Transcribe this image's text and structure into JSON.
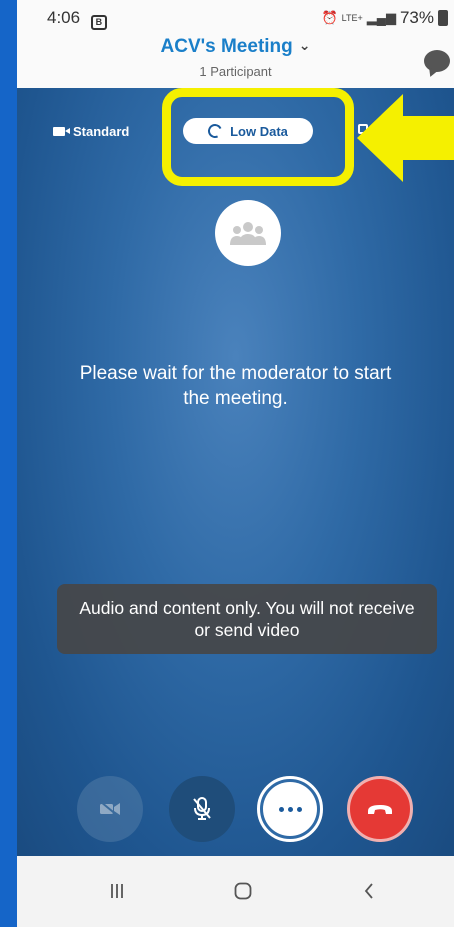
{
  "status_bar": {
    "time": "4:06",
    "notification_badge": "B",
    "signal_text": "LTE+",
    "battery": "73%"
  },
  "header": {
    "title": "ACV's Meeting",
    "participants": "1 Participant"
  },
  "modes": {
    "standard_label": "Standard",
    "low_data_label": "Low Data"
  },
  "main": {
    "wait_message": "Please wait for the moderator to start the meeting."
  },
  "toast": {
    "message": "Audio and content only. You will not receive or send video"
  },
  "colors": {
    "accent": "#1a7fc9",
    "highlight": "#f5f000",
    "end_call": "#e53935",
    "frame": "#1565c8"
  },
  "icons": {
    "camera": "video-camera-icon",
    "low_data": "ring-icon",
    "avatar": "group-icon",
    "mute": "microphone-off-icon",
    "more": "more-dots-icon",
    "end": "phone-hangup-icon",
    "chat": "chat-bubble-icon"
  }
}
